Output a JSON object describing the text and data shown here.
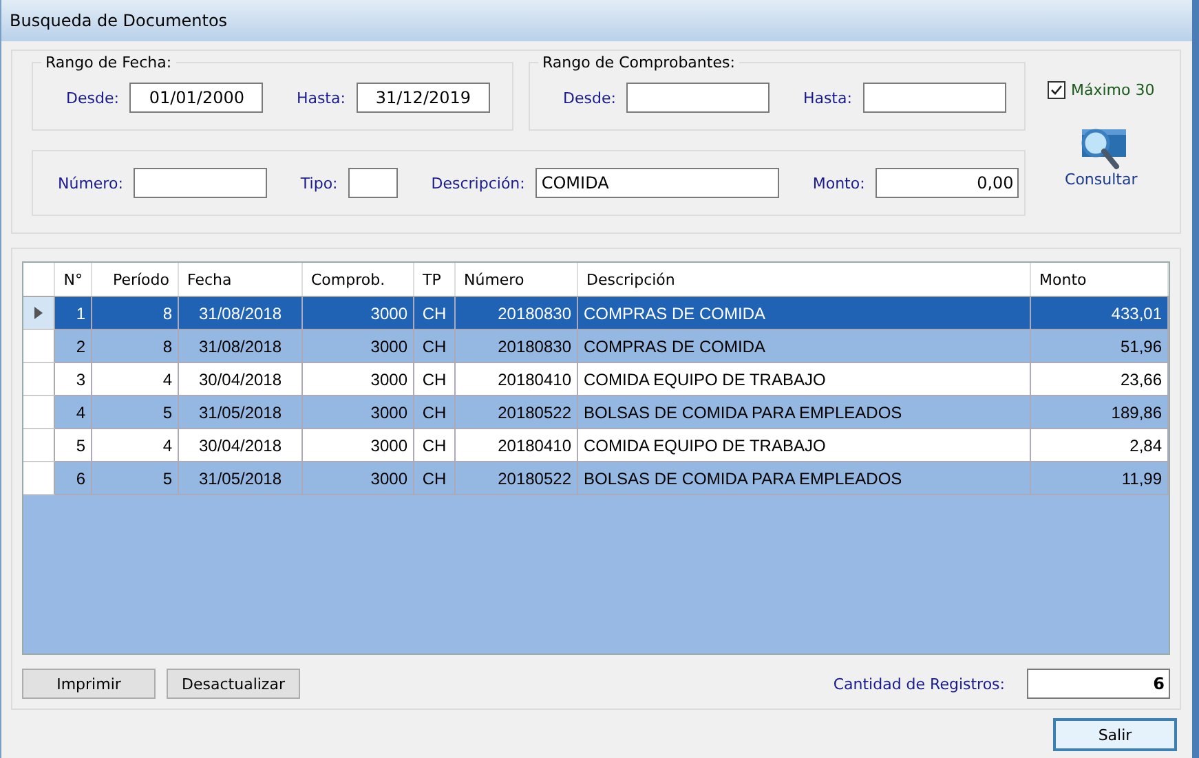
{
  "window": {
    "title": "Busqueda de Documentos"
  },
  "date_range": {
    "legend": "Rango de Fecha:",
    "from_label": "Desde:",
    "from_value": "01/01/2000",
    "to_label": "Hasta:",
    "to_value": "31/12/2019"
  },
  "voucher_range": {
    "legend": "Rango de Comprobantes:",
    "from_label": "Desde:",
    "to_label": "Hasta:"
  },
  "max_checkbox": {
    "label": "Máximo 30",
    "checked": true
  },
  "filters": [
    {
      "label": "Número:"
    },
    {
      "label": "Tipo:"
    },
    {
      "label": "Descripción:",
      "value": "COMIDA"
    },
    {
      "label": "Monto:",
      "value": "0,00"
    }
  ],
  "search_button": {
    "label": "Consultar"
  },
  "table": {
    "columns": [
      "N°",
      "Período",
      "Fecha",
      "Comprob.",
      "TP",
      "Número",
      "Descripción",
      "Monto"
    ],
    "rows": [
      {
        "cells": [
          "1",
          "8",
          "31/08/2018",
          "3000",
          "CH",
          "20180830",
          "COMPRAS DE COMIDA",
          "433,01"
        ],
        "selected": true
      },
      {
        "cells": [
          "2",
          "8",
          "31/08/2018",
          "3000",
          "CH",
          "20180830",
          "COMPRAS DE COMIDA",
          "51,96"
        ],
        "selected": false
      },
      {
        "cells": [
          "3",
          "4",
          "30/04/2018",
          "3000",
          "CH",
          "20180410",
          "COMIDA EQUIPO DE TRABAJO",
          "23,66"
        ],
        "selected": false
      },
      {
        "cells": [
          "4",
          "5",
          "31/05/2018",
          "3000",
          "CH",
          "20180522",
          "BOLSAS DE COMIDA PARA EMPLEADOS",
          "189,86"
        ],
        "selected": false
      },
      {
        "cells": [
          "5",
          "4",
          "30/04/2018",
          "3000",
          "CH",
          "20180410",
          "COMIDA EQUIPO DE TRABAJO",
          "2,84"
        ],
        "selected": false
      },
      {
        "cells": [
          "6",
          "5",
          "31/05/2018",
          "3000",
          "CH",
          "20180522",
          "BOLSAS DE COMIDA PARA EMPLEADOS",
          "11,99"
        ],
        "selected": false
      }
    ]
  },
  "buttons": [
    "Imprimir",
    "Desactualizar"
  ],
  "record_count": {
    "label": "Cantidad de Registros:",
    "value": "6"
  },
  "exit_button": "Salir"
}
